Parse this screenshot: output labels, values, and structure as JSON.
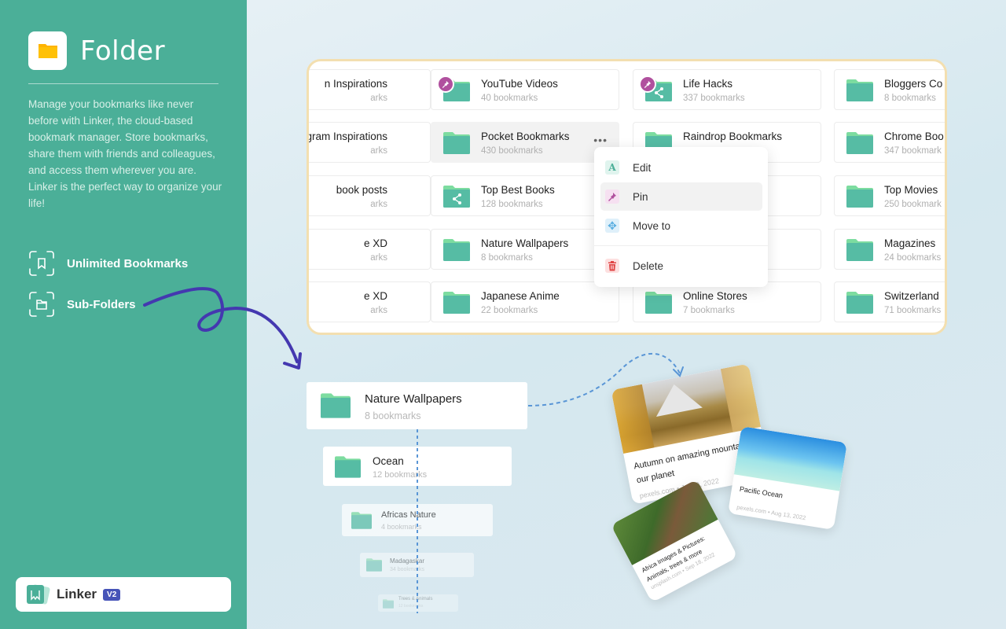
{
  "sidebar": {
    "title": "Folder",
    "description": "Manage your bookmarks like never before with Linker, the cloud-based bookmark manager. Store bookmarks, share them with friends and colleagues, and access them wherever you are. Linker is the perfect way to organize your life!",
    "features": [
      {
        "label": "Unlimited Bookmarks",
        "icon": "bookmark-icon"
      },
      {
        "label": "Sub-Folders",
        "icon": "folder-icon"
      }
    ],
    "app": {
      "name": "Linker",
      "version": "V2"
    }
  },
  "grid": {
    "columns": [
      [
        {
          "name": "n Inspirations",
          "count": "arks"
        },
        {
          "name": "gram Inspirations",
          "count": "arks"
        },
        {
          "name": "book posts",
          "count": "arks"
        },
        {
          "name": "e XD",
          "count": "arks"
        },
        {
          "name": "e XD",
          "count": "arks"
        }
      ],
      [
        {
          "name": "YouTube Videos",
          "count": "40 bookmarks",
          "pinned": true
        },
        {
          "name": "Pocket Bookmarks",
          "count": "430 bookmarks",
          "active": true
        },
        {
          "name": "Top Best Books",
          "count": "128 bookmarks",
          "shared": true
        },
        {
          "name": "Nature Wallpapers",
          "count": "8 bookmarks"
        },
        {
          "name": "Japanese Anime",
          "count": "22 bookmarks"
        }
      ],
      [
        {
          "name": "Life Hacks",
          "count": "337 bookmarks",
          "pinned": true,
          "shared": true
        },
        {
          "name": "Raindrop Bookmarks",
          "count": ""
        },
        {
          "name": "",
          "count": ""
        },
        {
          "name": "",
          "count": ""
        },
        {
          "name": "Online Stores",
          "count": "7 bookmarks"
        }
      ],
      [
        {
          "name": "Bloggers Co",
          "count": "8 bookmarks"
        },
        {
          "name": "Chrome Boo",
          "count": "347 bookmark"
        },
        {
          "name": "Top Movies",
          "count": "250 bookmark"
        },
        {
          "name": "Magazines",
          "count": "24 bookmarks"
        },
        {
          "name": "Switzerland",
          "count": "71 bookmarks"
        }
      ]
    ],
    "more_label": "•••"
  },
  "context_menu": {
    "items": [
      {
        "label": "Edit",
        "icon": "edit-icon",
        "glyph": "A",
        "color": "#4baf98",
        "bg": "#e0f4ee"
      },
      {
        "label": "Pin",
        "icon": "pin-icon",
        "glyph": "",
        "color": "#b0509e",
        "bg": "#f6e0f1",
        "hover": true
      },
      {
        "label": "Move to",
        "icon": "move-icon",
        "glyph": "✥",
        "color": "#5aaee0",
        "bg": "#dff0fa"
      },
      {
        "label": "Delete",
        "icon": "trash-icon",
        "glyph": "",
        "color": "#e04444",
        "bg": "#fde0e0"
      }
    ]
  },
  "tree": [
    {
      "name": "Nature Wallpapers",
      "count": "8 bookmarks"
    },
    {
      "name": "Ocean",
      "count": "12 bookmarks"
    },
    {
      "name": "Africas Nature",
      "count": "4 bookmarks"
    },
    {
      "name": "Madagaskar",
      "count": "34 bookmarks"
    },
    {
      "name": "Trees & Animals",
      "count": "12 bookmarks"
    }
  ],
  "cards": [
    {
      "title": "Autumn on amazing mountain our planet",
      "source": "pexels.com",
      "date": "Jul 20, 2022"
    },
    {
      "title": "Pacific Ocean",
      "source": "pexels.com",
      "date": "Aug 13, 2022"
    },
    {
      "title": "Africa Images & Pictures: Animals, trees & more",
      "source": "unsplash.com",
      "date": "Sep 18, 2022"
    }
  ],
  "colors": {
    "sidebar": "#4baf98",
    "folder": "#56bca4",
    "folder_tab": "#7ddca0",
    "pin": "#b0509e",
    "arrow": "#4438b0",
    "accent_border": "#f3dfb0"
  }
}
